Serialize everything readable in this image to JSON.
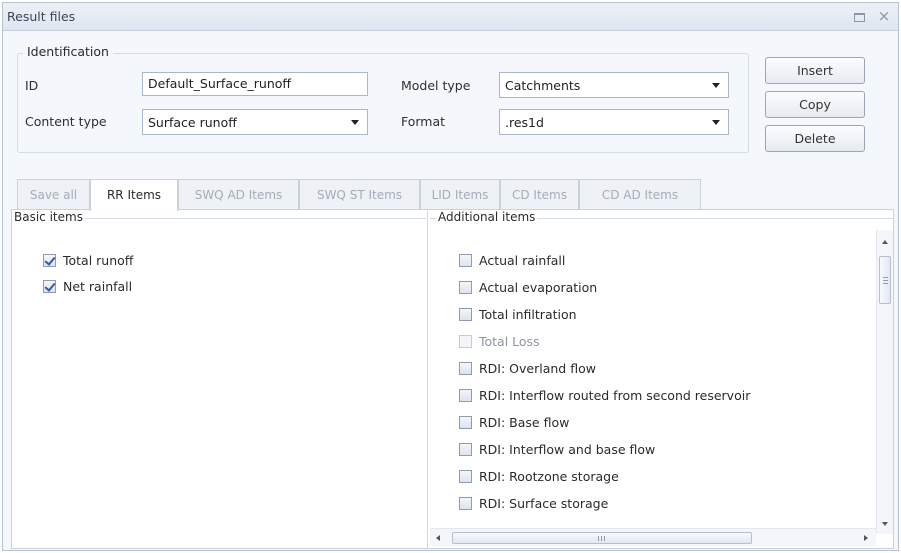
{
  "window": {
    "title": "Result files",
    "restore_icon": "restore-icon",
    "close_glyph": "×"
  },
  "identification": {
    "legend": "Identification",
    "id_label": "ID",
    "id_value": "Default_Surface_runoff",
    "content_type_label": "Content type",
    "content_type_value": "Surface runoff",
    "model_type_label": "Model type",
    "model_type_value": "Catchments",
    "format_label": "Format",
    "format_value": ".res1d"
  },
  "actions": {
    "insert": "Insert",
    "copy": "Copy",
    "delete": "Delete"
  },
  "tabs": [
    {
      "label": "Save all",
      "active": false
    },
    {
      "label": "RR Items",
      "active": true
    },
    {
      "label": "SWQ AD Items",
      "active": false
    },
    {
      "label": "SWQ ST Items",
      "active": false
    },
    {
      "label": "LID Items",
      "active": false
    },
    {
      "label": "CD Items",
      "active": false
    },
    {
      "label": "CD AD Items",
      "active": false
    }
  ],
  "basic_items": {
    "title": "Basic items",
    "items": [
      {
        "label": "Total runoff",
        "checked": true
      },
      {
        "label": "Net rainfall",
        "checked": true
      }
    ]
  },
  "additional_items": {
    "title": "Additional items",
    "items": [
      {
        "label": "Actual rainfall",
        "checked": false,
        "enabled": true
      },
      {
        "label": "Actual evaporation",
        "checked": false,
        "enabled": true
      },
      {
        "label": "Total infiltration",
        "checked": false,
        "enabled": true
      },
      {
        "label": "Total Loss",
        "checked": false,
        "enabled": false
      },
      {
        "label": "RDI: Overland flow",
        "checked": false,
        "enabled": true
      },
      {
        "label": "RDI: Interflow routed from second reservoir",
        "checked": false,
        "enabled": true
      },
      {
        "label": "RDI: Base flow",
        "checked": false,
        "enabled": true
      },
      {
        "label": "RDI: Interflow and base flow",
        "checked": false,
        "enabled": true
      },
      {
        "label": "RDI: Rootzone storage",
        "checked": false,
        "enabled": true
      },
      {
        "label": "RDI: Surface storage",
        "checked": false,
        "enabled": true
      }
    ]
  },
  "colors": {
    "accent": "#2a5caa",
    "disabled_text": "#8c95a3",
    "border": "#c8d1dd"
  }
}
